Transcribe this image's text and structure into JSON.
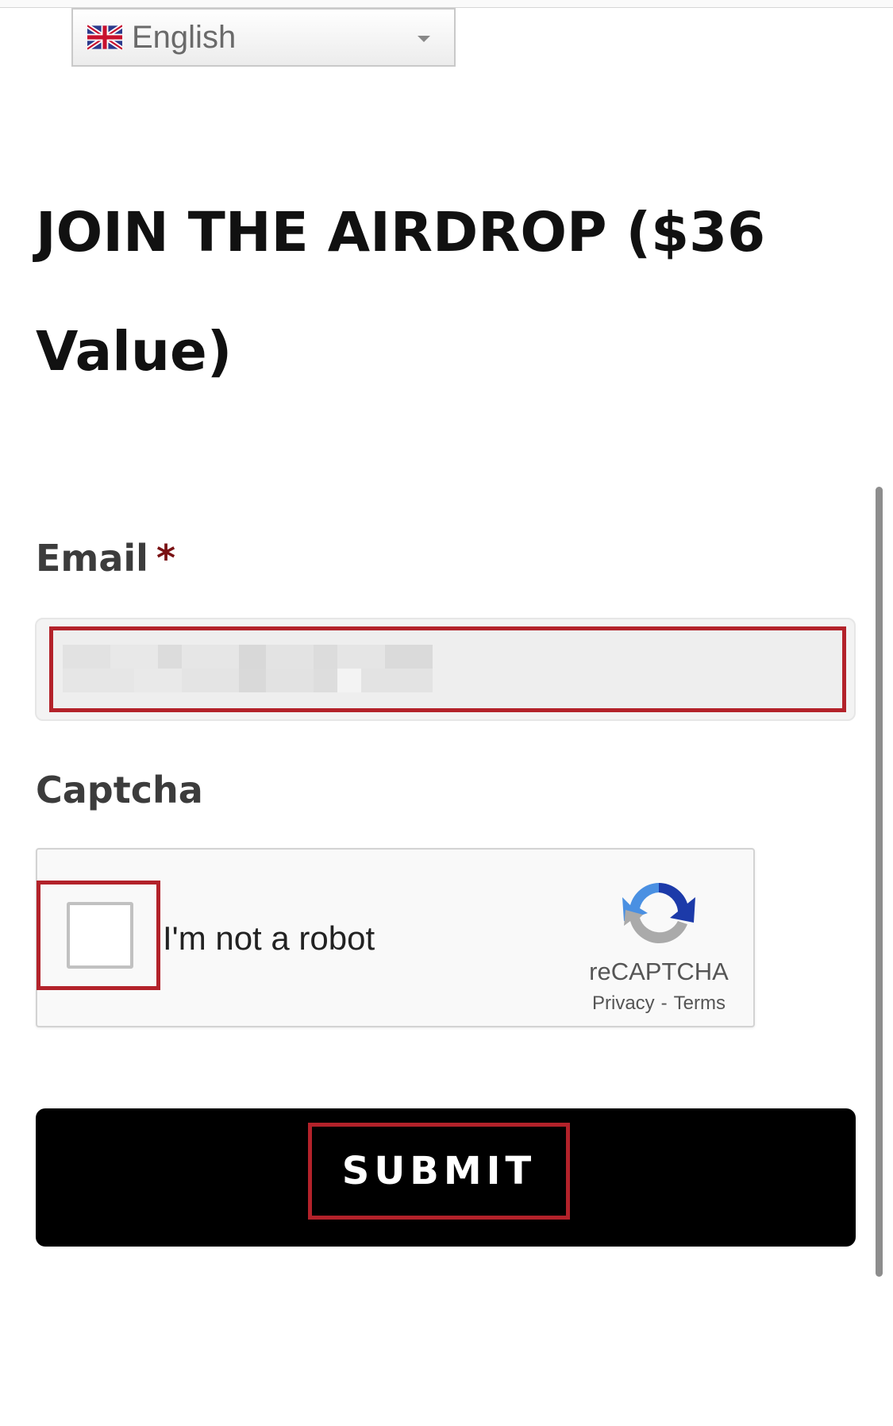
{
  "language_select": {
    "selected": "English",
    "flag_icon": "uk-flag-icon",
    "caret_icon": "chevron-down-icon"
  },
  "form": {
    "title_line1": "JOIN THE AIRDROP ($36",
    "title_line2": "Value)",
    "email": {
      "label": "Email",
      "required_mark": "*",
      "value": ""
    },
    "captcha": {
      "label": "Captcha",
      "checkbox_text": "I'm not a robot",
      "brand": "reCAPTCHA",
      "privacy": "Privacy",
      "separator": "-",
      "terms": "Terms",
      "logo_icon": "recaptcha-logo-icon"
    },
    "submit_label": "SUBMIT"
  },
  "colors": {
    "highlight": "#b3222a",
    "required": "#7a1214",
    "button_bg": "#000000",
    "button_text": "#ffffff"
  }
}
